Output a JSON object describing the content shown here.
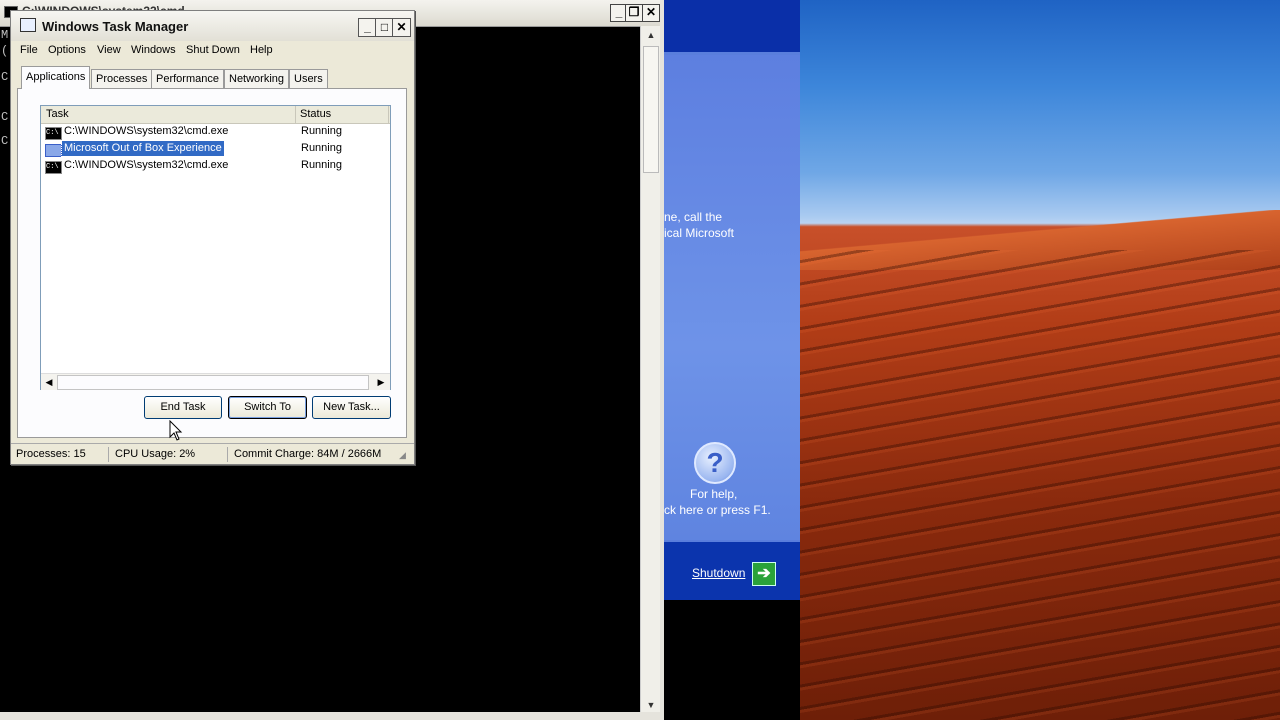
{
  "cmd_window": {
    "title": "C:\\WINDOWS\\system32\\cmd",
    "side_chars": [
      "M",
      "(",
      "C",
      "C",
      "C"
    ],
    "buttons": {
      "minimize": "_",
      "restore": "❐",
      "close": "✕"
    }
  },
  "oobe": {
    "help_text_line1": "ne, call the",
    "help_text_line2": "ical Microsoft",
    "help_icon": "?",
    "for_help": "For help,",
    "click_here": "ck here or press F1.",
    "shutdown": "Shutdown",
    "shutdown_arrow": "➔"
  },
  "task_manager": {
    "title": "Windows Task Manager",
    "window_buttons": {
      "minimize": "_",
      "maximize": "□",
      "close": "✕"
    },
    "menu": [
      "File",
      "Options",
      "View",
      "Windows",
      "Shut Down",
      "Help"
    ],
    "tabs": [
      "Applications",
      "Processes",
      "Performance",
      "Networking",
      "Users"
    ],
    "active_tab": "Applications",
    "columns": {
      "task": "Task",
      "status": "Status"
    },
    "rows": [
      {
        "task": "C:\\WINDOWS\\system32\\cmd.exe",
        "status": "Running",
        "icon": "cmd-icon",
        "icon_text": "C:\\"
      },
      {
        "task": "Microsoft Out of Box Experience",
        "status": "Running",
        "icon": "oobe-icon",
        "icon_text": ""
      },
      {
        "task": "C:\\WINDOWS\\system32\\cmd.exe",
        "status": "Running",
        "icon": "cmd-icon",
        "icon_text": "C:\\"
      }
    ],
    "selected_row": 1,
    "buttons": {
      "end_task": "End Task",
      "switch_to": "Switch To",
      "new_task": "New Task..."
    },
    "scroll_arrows": {
      "left": "◀",
      "right": "▶"
    },
    "status_bar": {
      "processes": "Processes: 15",
      "cpu": "CPU Usage: 2%",
      "commit": "Commit Charge: 84M / 2666M"
    }
  }
}
